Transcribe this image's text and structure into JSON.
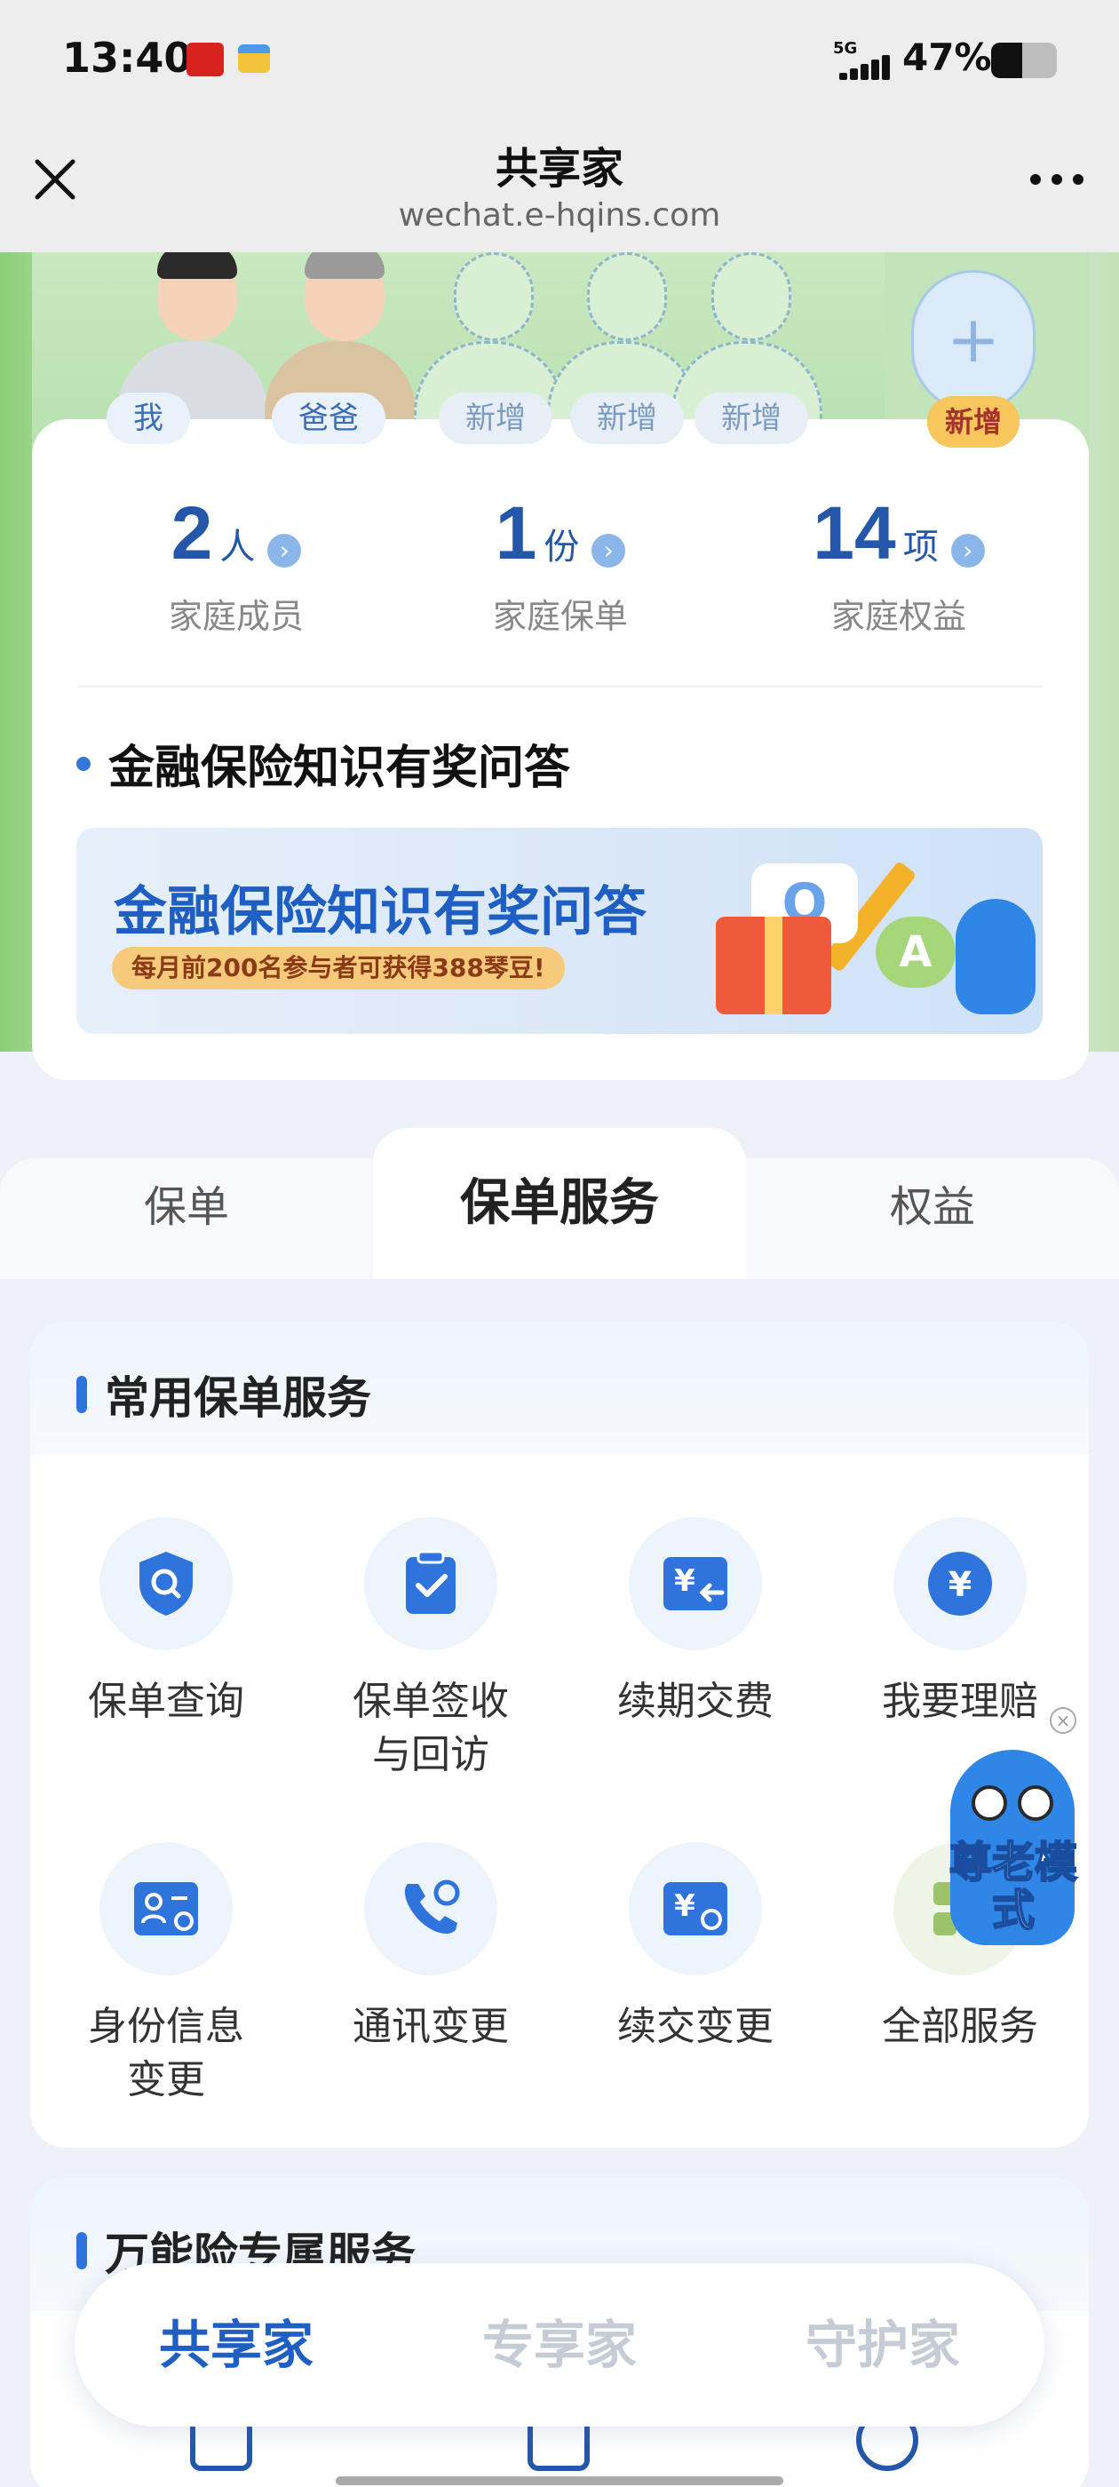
{
  "status_bar": {
    "time": "13:40",
    "network": "5G",
    "battery_percent": "47%",
    "battery_level": 0.47
  },
  "nav": {
    "title": "共享家",
    "subtitle": "wechat.e-hqins.com"
  },
  "family": {
    "members": [
      {
        "label": "我",
        "kind": "person"
      },
      {
        "label": "爸爸",
        "kind": "person"
      },
      {
        "label": "新增",
        "kind": "placeholder"
      },
      {
        "label": "新增",
        "kind": "placeholder"
      },
      {
        "label": "新增",
        "kind": "placeholder"
      }
    ],
    "add_label": "新增"
  },
  "summary": {
    "stats": [
      {
        "num": "2",
        "unit": "人",
        "label": "家庭成员"
      },
      {
        "num": "1",
        "unit": "份",
        "label": "家庭保单"
      },
      {
        "num": "14",
        "unit": "项",
        "label": "家庭权益"
      }
    ],
    "quiz_title": "金融保险知识有奖问答",
    "banner_title": "金融保险知识有奖问答",
    "banner_sub": "每月前200名参与者可获得388琴豆!"
  },
  "tabs": [
    {
      "label": "保单",
      "active": false
    },
    {
      "label": "保单服务",
      "active": true
    },
    {
      "label": "权益",
      "active": false
    }
  ],
  "services": {
    "title": "常用保单服务",
    "items": [
      {
        "label": "保单查询",
        "icon": "shield-search-icon"
      },
      {
        "label": "保单签收\n与回访",
        "icon": "clipboard-check-icon"
      },
      {
        "label": "续期交费",
        "icon": "yuan-card-icon"
      },
      {
        "label": "我要理赔",
        "icon": "yuan-circle-icon"
      },
      {
        "label": "身份信息\n变更",
        "icon": "id-card-refresh-icon"
      },
      {
        "label": "通讯变更",
        "icon": "phone-refresh-icon"
      },
      {
        "label": "续交变更",
        "icon": "yuan-refresh-icon"
      },
      {
        "label": "全部服务",
        "icon": "grid-icon"
      }
    ]
  },
  "elder_mode": {
    "label": "尊老模式"
  },
  "universal_card": {
    "title": "万能险专属服务"
  },
  "bottom_nav": [
    {
      "label": "共享家",
      "active": true
    },
    {
      "label": "专享家",
      "active": false
    },
    {
      "label": "守护家",
      "active": false
    }
  ],
  "colors": {
    "accent": "#2457a8",
    "primary_blue": "#2f74dc",
    "orange": "#f19a2b"
  }
}
